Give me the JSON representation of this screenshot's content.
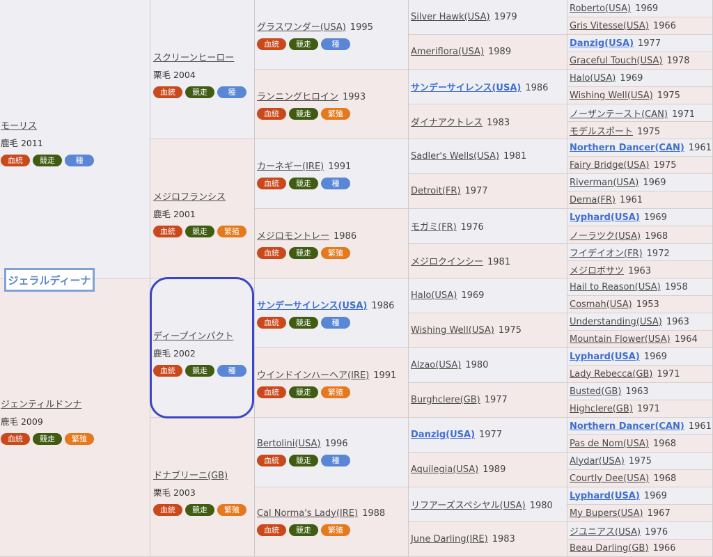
{
  "subject": "ジェラルディーナ",
  "badge_labels": {
    "blood": "血統",
    "race": "競走",
    "stud": "種",
    "breed": "繁殖"
  },
  "gen1": [
    {
      "name": "モーリス",
      "sub": "鹿毛 2011",
      "badge3": "stud"
    },
    {
      "name": "ジェンティルドンナ",
      "sub": "鹿毛 2009",
      "badge3": "breed"
    }
  ],
  "gen2": [
    {
      "name": "スクリーンヒーロー",
      "sub": "栗毛 2004",
      "badge3": "stud"
    },
    {
      "name": "メジロフランシス",
      "sub": "鹿毛 2001",
      "badge3": "breed"
    },
    {
      "name": "ディープインパクト",
      "sub": "鹿毛 2002",
      "badge3": "stud"
    },
    {
      "name": "ドナブリーニ(GB)",
      "sub": "栗毛 2003",
      "badge3": "breed"
    }
  ],
  "gen3": [
    {
      "name": "グラスワンダー(USA)",
      "year": "1995",
      "badge3": "stud",
      "bold": false
    },
    {
      "name": "ランニングヒロイン",
      "year": "1993",
      "badge3": "breed",
      "bold": false
    },
    {
      "name": "カーネギー(IRE)",
      "year": "1991",
      "badge3": "stud",
      "bold": false
    },
    {
      "name": "メジロモントレー",
      "year": "1986",
      "badge3": "breed",
      "bold": false
    },
    {
      "name": "サンデーサイレンス(USA)",
      "year": "1986",
      "badge3": "stud",
      "bold": true
    },
    {
      "name": "ウインドインハーヘア(IRE)",
      "year": "1991",
      "badge3": "breed",
      "bold": false
    },
    {
      "name": "Bertolini(USA)",
      "year": "1996",
      "badge3": "stud",
      "bold": false
    },
    {
      "name": "Cal Norma's Lady(IRE)",
      "year": "1988",
      "badge3": "breed",
      "bold": false
    }
  ],
  "gen4": [
    {
      "name": "Silver Hawk(USA)",
      "year": "1979",
      "bold": false
    },
    {
      "name": "Ameriflora(USA)",
      "year": "1989",
      "bold": false
    },
    {
      "name": "サンデーサイレンス(USA)",
      "year": "1986",
      "bold": true
    },
    {
      "name": "ダイナアクトレス",
      "year": "1983",
      "bold": false
    },
    {
      "name": "Sadler's Wells(USA)",
      "year": "1981",
      "bold": false
    },
    {
      "name": "Detroit(FR)",
      "year": "1977",
      "bold": false
    },
    {
      "name": "モガミ(FR)",
      "year": "1976",
      "bold": false
    },
    {
      "name": "メジロクインシー",
      "year": "1981",
      "bold": false
    },
    {
      "name": "Halo(USA)",
      "year": "1969",
      "bold": false
    },
    {
      "name": "Wishing Well(USA)",
      "year": "1975",
      "bold": false
    },
    {
      "name": "Alzao(USA)",
      "year": "1980",
      "bold": false
    },
    {
      "name": "Burghclere(GB)",
      "year": "1977",
      "bold": false
    },
    {
      "name": "Danzig(USA)",
      "year": "1977",
      "bold": true
    },
    {
      "name": "Aquilegia(USA)",
      "year": "1989",
      "bold": false
    },
    {
      "name": "リフアーズスペシヤル(USA)",
      "year": "1980",
      "bold": false
    },
    {
      "name": "June Darling(IRE)",
      "year": "1983",
      "bold": false
    }
  ],
  "gen5": [
    {
      "name": "Roberto(USA)",
      "year": "1969",
      "bold": false
    },
    {
      "name": "Gris Vitesse(USA)",
      "year": "1966",
      "bold": false
    },
    {
      "name": "Danzig(USA)",
      "year": "1977",
      "bold": true
    },
    {
      "name": "Graceful Touch(USA)",
      "year": "1978",
      "bold": false
    },
    {
      "name": "Halo(USA)",
      "year": "1969",
      "bold": false
    },
    {
      "name": "Wishing Well(USA)",
      "year": "1975",
      "bold": false
    },
    {
      "name": "ノーザンテースト(CAN)",
      "year": "1971",
      "bold": false
    },
    {
      "name": "モデルスポート",
      "year": "1975",
      "bold": false
    },
    {
      "name": "Northern Dancer(CAN)",
      "year": "1961",
      "bold": true
    },
    {
      "name": "Fairy Bridge(USA)",
      "year": "1975",
      "bold": false
    },
    {
      "name": "Riverman(USA)",
      "year": "1969",
      "bold": false
    },
    {
      "name": "Derna(FR)",
      "year": "1961",
      "bold": false
    },
    {
      "name": "Lyphard(USA)",
      "year": "1969",
      "bold": true
    },
    {
      "name": "ノーラツク(USA)",
      "year": "1968",
      "bold": false
    },
    {
      "name": "フイデイオン(FR)",
      "year": "1972",
      "bold": false
    },
    {
      "name": "メジロボサツ",
      "year": "1963",
      "bold": false
    },
    {
      "name": "Hail to Reason(USA)",
      "year": "1958",
      "bold": false
    },
    {
      "name": "Cosmah(USA)",
      "year": "1953",
      "bold": false
    },
    {
      "name": "Understanding(USA)",
      "year": "1963",
      "bold": false
    },
    {
      "name": "Mountain Flower(USA)",
      "year": "1964",
      "bold": false
    },
    {
      "name": "Lyphard(USA)",
      "year": "1969",
      "bold": true
    },
    {
      "name": "Lady Rebecca(GB)",
      "year": "1971",
      "bold": false
    },
    {
      "name": "Busted(GB)",
      "year": "1963",
      "bold": false
    },
    {
      "name": "Highclere(GB)",
      "year": "1971",
      "bold": false
    },
    {
      "name": "Northern Dancer(CAN)",
      "year": "1961",
      "bold": true
    },
    {
      "name": "Pas de Nom(USA)",
      "year": "1968",
      "bold": false
    },
    {
      "name": "Alydar(USA)",
      "year": "1975",
      "bold": false
    },
    {
      "name": "Courtly Dee(USA)",
      "year": "1968",
      "bold": false
    },
    {
      "name": "Lyphard(USA)",
      "year": "1969",
      "bold": true
    },
    {
      "name": "My Bupers(USA)",
      "year": "1967",
      "bold": false
    },
    {
      "name": "ジユニアス(USA)",
      "year": "1976",
      "bold": false
    },
    {
      "name": "Beau Darling(GB)",
      "year": "1966",
      "bold": false
    }
  ]
}
